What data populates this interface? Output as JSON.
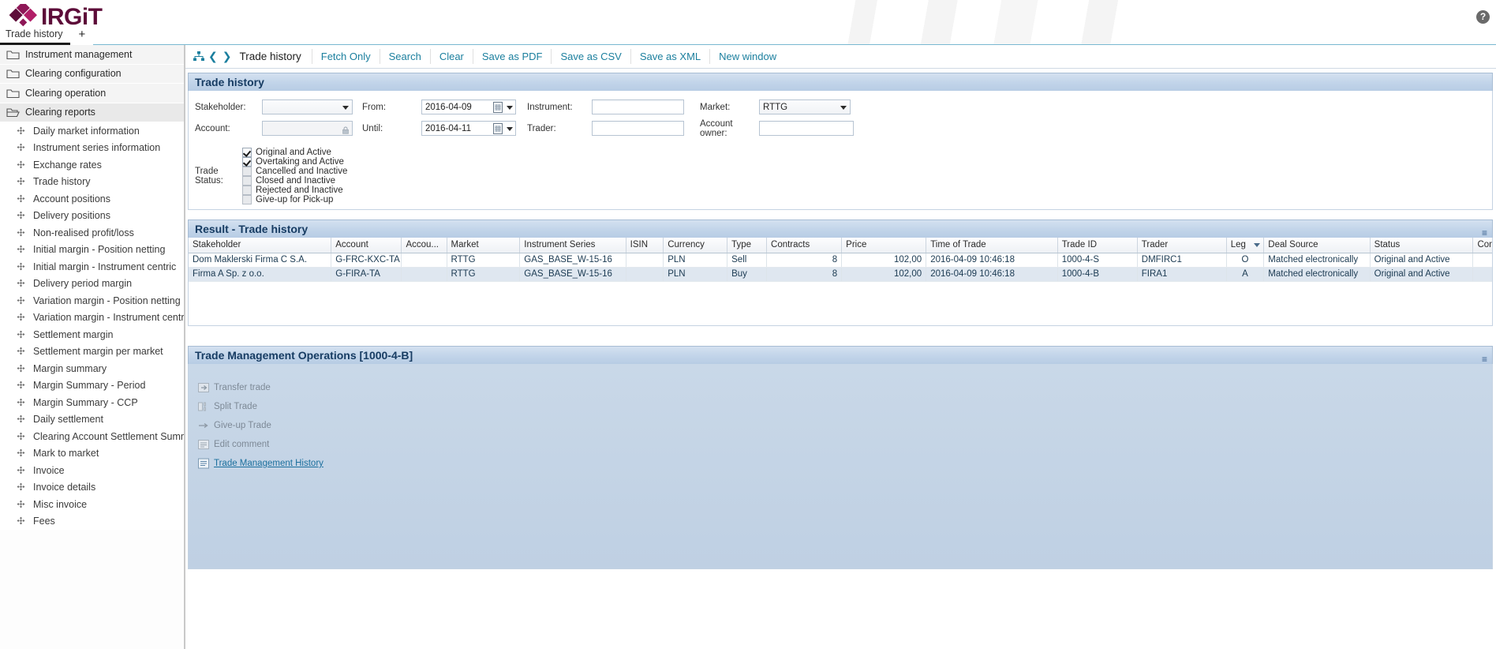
{
  "app": {
    "logo_text": "IRGiT",
    "brand_color": "#5d0c39",
    "accent_color": "#1b7f9e",
    "help_label": "?"
  },
  "tabs": {
    "items": [
      {
        "label": "Trade history"
      }
    ],
    "add_label": "+"
  },
  "sidebar": {
    "top_items": [
      {
        "label": "Instrument management",
        "icon": "folder-closed-icon"
      },
      {
        "label": "Clearing configuration",
        "icon": "folder-closed-icon"
      },
      {
        "label": "Clearing operation",
        "icon": "folder-closed-icon"
      },
      {
        "label": "Clearing reports",
        "icon": "folder-open-icon"
      }
    ],
    "sub_items": [
      {
        "label": "Daily market information"
      },
      {
        "label": "Instrument series information"
      },
      {
        "label": "Exchange rates"
      },
      {
        "label": "Trade history"
      },
      {
        "label": "Account positions"
      },
      {
        "label": "Delivery positions"
      },
      {
        "label": "Non-realised profit/loss"
      },
      {
        "label": "Initial margin - Position netting"
      },
      {
        "label": "Initial margin - Instrument centric"
      },
      {
        "label": "Delivery period margin"
      },
      {
        "label": "Variation margin - Position netting"
      },
      {
        "label": "Variation margin - Instrument centric"
      },
      {
        "label": "Settlement margin"
      },
      {
        "label": "Settlement margin per market"
      },
      {
        "label": "Margin summary"
      },
      {
        "label": "Margin Summary - Period"
      },
      {
        "label": "Margin Summary - CCP"
      },
      {
        "label": "Daily settlement"
      },
      {
        "label": "Clearing Account Settlement Summary"
      },
      {
        "label": "Mark to market"
      },
      {
        "label": "Invoice"
      },
      {
        "label": "Invoice details"
      },
      {
        "label": "Misc invoice"
      },
      {
        "label": "Fees"
      }
    ]
  },
  "toolbar": {
    "title": "Trade history",
    "links": [
      {
        "label": "Fetch Only"
      },
      {
        "label": "Search"
      },
      {
        "label": "Clear"
      },
      {
        "label": "Save as PDF"
      },
      {
        "label": "Save as CSV"
      },
      {
        "label": "Save as XML"
      },
      {
        "label": "New window"
      }
    ]
  },
  "search_panel": {
    "title": "Trade history",
    "fields": {
      "stakeholder_label": "Stakeholder:",
      "stakeholder_value": "",
      "account_label": "Account:",
      "account_value": "",
      "from_label": "From:",
      "from_value": "2016-04-09",
      "until_label": "Until:",
      "until_value": "2016-04-11",
      "instrument_label": "Instrument:",
      "instrument_value": "",
      "trader_label": "Trader:",
      "trader_value": "",
      "market_label": "Market:",
      "market_value": "RTTG",
      "account_owner_label": "Account owner:",
      "account_owner_value": ""
    },
    "trade_status": {
      "label": "Trade Status:",
      "options": [
        {
          "label": "Original and Active",
          "checked": true
        },
        {
          "label": "Overtaking and Active",
          "checked": true
        },
        {
          "label": "Cancelled and Inactive",
          "checked": false
        },
        {
          "label": "Closed and Inactive",
          "checked": false
        },
        {
          "label": "Rejected and Inactive",
          "checked": false
        },
        {
          "label": "Give-up for Pick-up",
          "checked": false
        }
      ]
    }
  },
  "result_panel": {
    "title": "Result - Trade history",
    "columns": [
      "Stakeholder",
      "Account",
      "Accou...",
      "Market",
      "Instrument Series",
      "ISIN",
      "Currency",
      "Type",
      "Contracts",
      "Price",
      "Time of Trade",
      "Trade ID",
      "Trader",
      "Leg",
      "Deal Source",
      "Status",
      "Com"
    ],
    "sorted_column": "Leg",
    "rows": [
      {
        "stakeholder": "Dom Maklerski Firma C S.A.",
        "account": "G-FRC-KXC-TA",
        "account2": "",
        "market": "RTTG",
        "instrument_series": "GAS_BASE_W-15-16",
        "isin": "",
        "currency": "PLN",
        "type": "Sell",
        "contracts": "8",
        "price": "102,00",
        "time_of_trade": "2016-04-09 10:46:18",
        "trade_id": "1000-4-S",
        "trader": "DMFIRC1",
        "leg": "O",
        "deal_source": "Matched electronically",
        "status": "Original and Active",
        "comment": ""
      },
      {
        "stakeholder": "Firma A Sp. z o.o.",
        "account": "G-FIRA-TA",
        "account2": "",
        "market": "RTTG",
        "instrument_series": "GAS_BASE_W-15-16",
        "isin": "",
        "currency": "PLN",
        "type": "Buy",
        "contracts": "8",
        "price": "102,00",
        "time_of_trade": "2016-04-09 10:46:18",
        "trade_id": "1000-4-B",
        "trader": "FIRA1",
        "leg": "A",
        "deal_source": "Matched electronically",
        "status": "Original and Active",
        "comment": ""
      }
    ]
  },
  "tmo_panel": {
    "title": "Trade Management Operations [1000-4-B]",
    "operations": [
      {
        "label": "Transfer trade",
        "icon": "transfer-trade-icon",
        "enabled": false
      },
      {
        "label": "Split Trade",
        "icon": "split-trade-icon",
        "enabled": false
      },
      {
        "label": "Give-up Trade",
        "icon": "give-up-trade-icon",
        "enabled": false
      },
      {
        "label": "Edit comment",
        "icon": "edit-comment-icon",
        "enabled": false
      },
      {
        "label": "Trade Management History",
        "icon": "history-icon",
        "enabled": true
      }
    ]
  }
}
